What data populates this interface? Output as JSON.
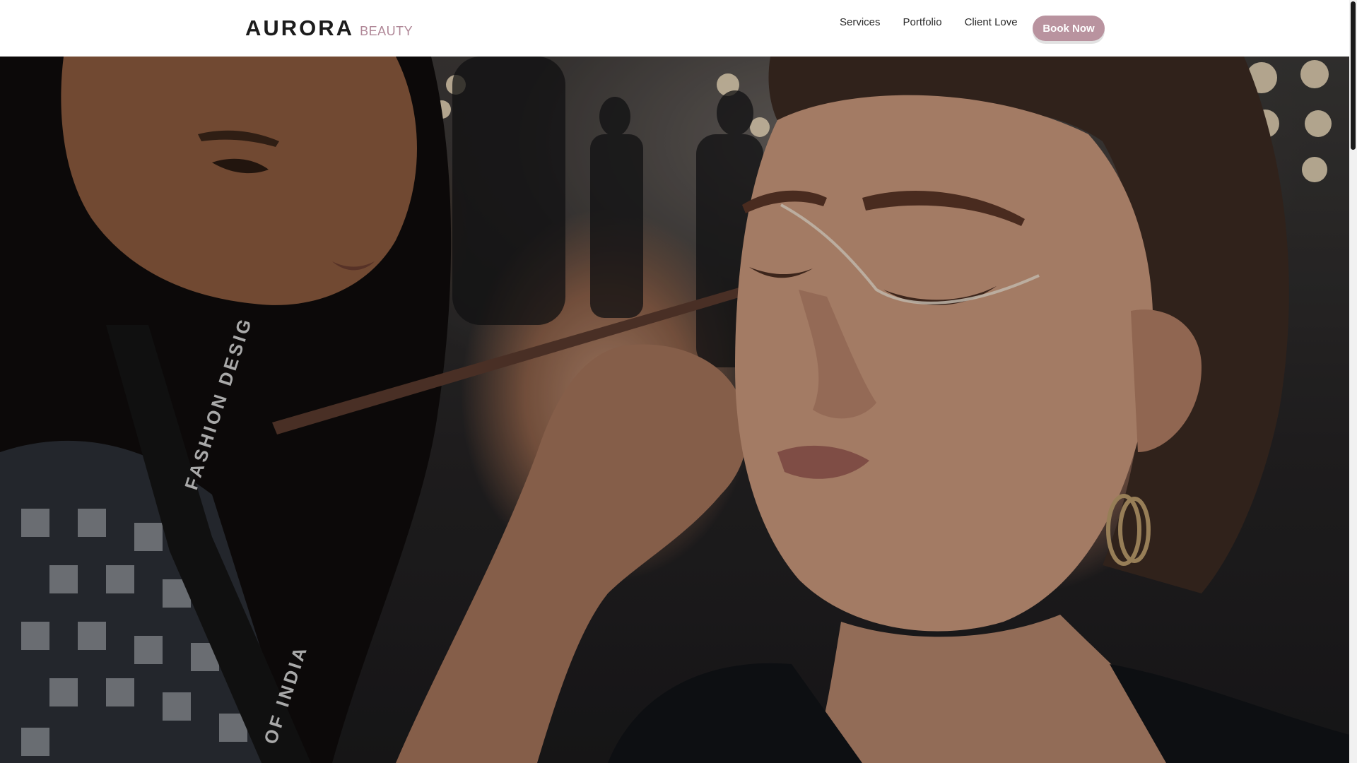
{
  "brand": {
    "name": "AURORA",
    "tagline": "BEAUTY",
    "accent_color": "#b9939f"
  },
  "nav": {
    "items": [
      {
        "label": "Services"
      },
      {
        "label": "Portfolio"
      },
      {
        "label": "Client Love"
      }
    ],
    "cta_label": "Book Now"
  },
  "hero": {
    "image_description_icon": "makeup-artist-photo",
    "lanyard_text_1": "FASHION DESIG",
    "lanyard_text_2": "OF INDIA"
  },
  "scrollbar": {
    "position": 0
  }
}
